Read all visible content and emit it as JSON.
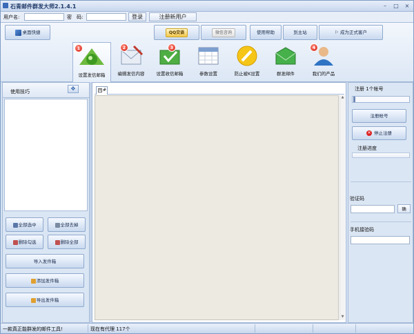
{
  "window": {
    "title": "石青邮件群发大师2.1.4.1",
    "controls": [
      "–",
      "□",
      "×"
    ]
  },
  "login": {
    "username_label": "用户名:",
    "username_value": "",
    "password_label": "密　码:",
    "password_value": "",
    "login_button": "登录",
    "register_button": "注册新用户"
  },
  "toolbar": {
    "desktop_shortcut": "桌面快捷",
    "qq_button": "QQ交谈",
    "wechat_button": "微信咨询",
    "help": "使用帮助",
    "to_home": "到主站",
    "become_customer": "成为正式客户",
    "tabs": [
      {
        "label": "设置发信邮箱",
        "badge": "1",
        "icon": "send-mailbox-icon"
      },
      {
        "label": "编辑发信内容",
        "badge": "2",
        "icon": "edit-content-icon"
      },
      {
        "label": "设置收信邮箱",
        "badge": "3",
        "icon": "receive-mailbox-icon"
      },
      {
        "label": "参数设置",
        "badge": "",
        "icon": "calendar-icon"
      },
      {
        "label": "防止被K设置",
        "badge": "",
        "icon": "wrench-icon"
      },
      {
        "label": "群发邮件",
        "badge": "",
        "icon": "envelope-icon"
      },
      {
        "label": "我们的产品",
        "badge": "4",
        "icon": "user-icon"
      }
    ]
  },
  "left_panel": {
    "title": "使用技巧",
    "select_all": "全部选中",
    "deselect_all": "全部去掉",
    "delete_checked": "删除勾选",
    "delete_all": "删除全部",
    "import_mailbox": "导入发件箱",
    "add_mailbox": "添加发件箱",
    "export_mailbox": "导出发件箱"
  },
  "center": {
    "tab_label": "#"
  },
  "right_panel": {
    "register_count": "注册 1个帐号",
    "register_account": "注册帐号",
    "stop_register": "停止注册",
    "register_progress": "注册进度",
    "captcha_label": "验证码",
    "captcha_confirm": "确",
    "phone_code_label": "手机接验码"
  },
  "status": {
    "slogan": "一款真正能群发的邮件工具!",
    "proxy": "现在有代理 117个"
  }
}
